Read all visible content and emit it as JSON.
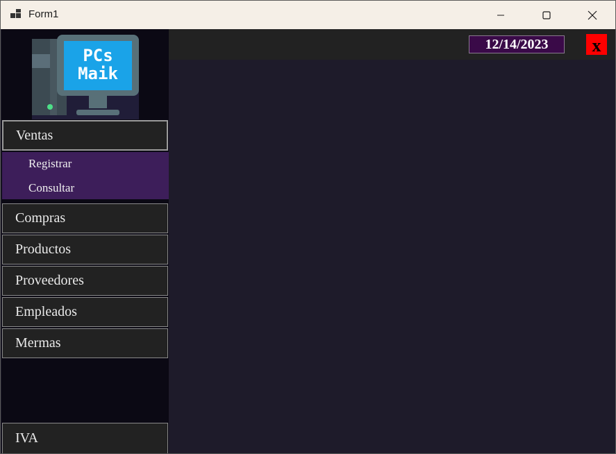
{
  "window": {
    "title": "Form1",
    "controls": {
      "minimize_icon": "minimize-icon",
      "maximize_icon": "maximize-icon",
      "close_icon": "close-icon"
    }
  },
  "logo": {
    "line1": "PCs",
    "line2": "Maik",
    "icon": "computer-icon"
  },
  "sidebar": {
    "ventas": "Ventas",
    "submenu": [
      {
        "label": "Registrar"
      },
      {
        "label": "Consultar"
      }
    ],
    "items": [
      {
        "label": "Compras"
      },
      {
        "label": "Productos"
      },
      {
        "label": "Proveedores"
      },
      {
        "label": "Empleados"
      },
      {
        "label": "Mermas"
      }
    ],
    "iva": "IVA"
  },
  "topbar": {
    "date": "12/14/2023",
    "close_label": "x"
  },
  "colors": {
    "sidebar_bg": "#0b0914",
    "menu_button_bg": "#222222",
    "submenu_bg": "#3d1e5a",
    "content_bg": "#1e1b2a",
    "date_bg": "#3a0a48",
    "close_bg": "#ff0000"
  }
}
